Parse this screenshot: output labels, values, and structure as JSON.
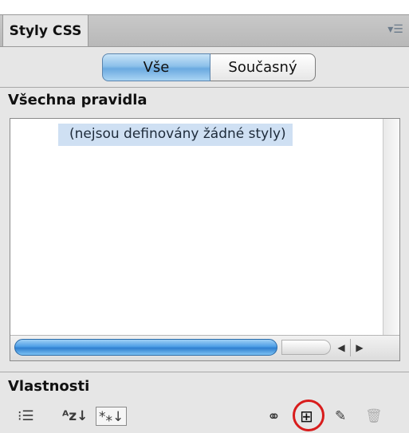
{
  "panel": {
    "tab_title": "Styly CSS",
    "menu_icon": "panel-menu-icon"
  },
  "toggle": {
    "all_label": "Vše",
    "current_label": "Současný",
    "selected": "Vše"
  },
  "rules_section": {
    "title": "Všechna pravidla",
    "empty_message": "(nejsou definovány žádné styly)"
  },
  "properties_section": {
    "title": "Vlastnosti"
  },
  "toolbar": {
    "category_view_icon": "category-view-icon",
    "category_view_glyph": "⁝☰",
    "list_view_icon": "alpha-list-view-icon",
    "list_view_glyph": "ᴬᴢ↓",
    "set_props_icon": "set-properties-icon",
    "set_props_glyph": "*⁎↓",
    "attach_icon": "attach-stylesheet-icon",
    "attach_glyph": "⚭",
    "new_rule_icon": "new-css-rule-icon",
    "new_rule_glyph": "⊞",
    "edit_icon": "edit-pencil-icon",
    "edit_glyph": "✎",
    "delete_icon": "trash-icon",
    "delete_glyph": "🗑"
  },
  "colors": {
    "highlight": "#d81c1c",
    "selection": "#cfe0f3",
    "accent_blue": "#4f9fe6"
  }
}
